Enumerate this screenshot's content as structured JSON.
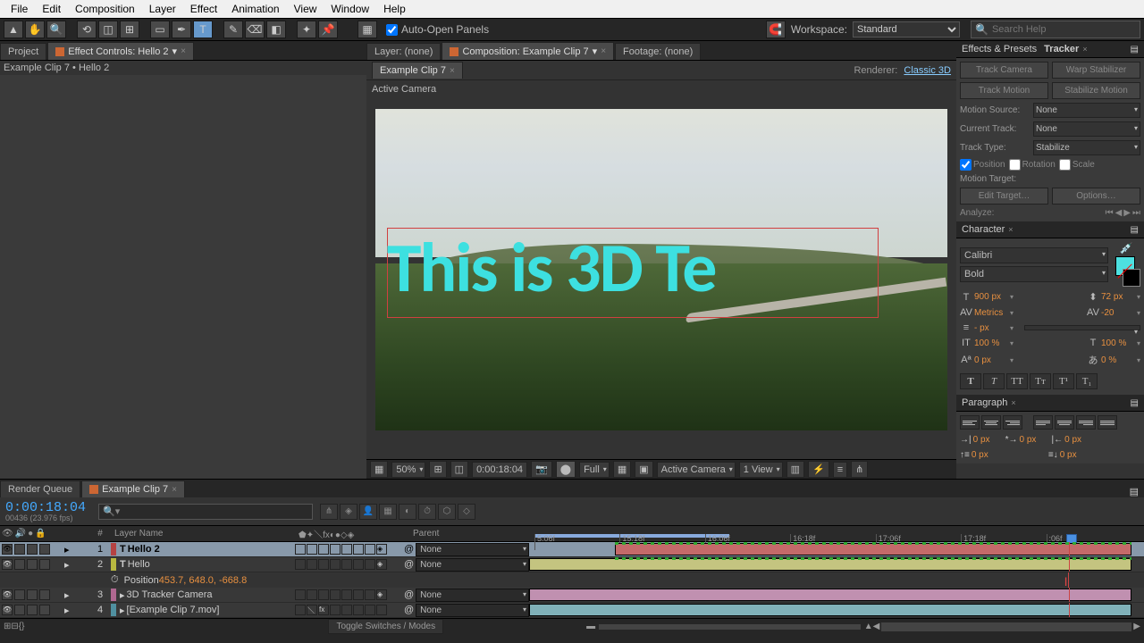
{
  "menubar": [
    "File",
    "Edit",
    "Composition",
    "Layer",
    "Effect",
    "Animation",
    "View",
    "Window",
    "Help"
  ],
  "toolbar": {
    "auto_open": "Auto-Open Panels",
    "workspace_label": "Workspace:",
    "workspace_value": "Standard",
    "search_placeholder": "Search Help"
  },
  "left": {
    "project_tab": "Project",
    "effect_tab": "Effect Controls: Hello 2",
    "subtext": "Example Clip 7 • Hello 2"
  },
  "center": {
    "layer_tab": "Layer: (none)",
    "comp_tab": "Composition: Example Clip 7",
    "footage_tab": "Footage: (none)",
    "tab2": "Example Clip 7",
    "renderer_label": "Renderer:",
    "renderer_value": "Classic 3D",
    "active_camera": "Active Camera",
    "text3d": "This is 3D Te",
    "footer": {
      "zoom": "50%",
      "time": "0:00:18:04",
      "quality": "Full",
      "camera": "Active Camera",
      "view": "1 View"
    }
  },
  "right": {
    "effects_presets": "Effects & Presets",
    "tracker": {
      "title": "Tracker",
      "track_camera": "Track Camera",
      "warp_stabilizer": "Warp Stabilizer",
      "track_motion": "Track Motion",
      "stabilize_motion": "Stabilize Motion",
      "motion_source": "Motion Source:",
      "motion_source_val": "None",
      "current_track": "Current Track:",
      "current_track_val": "None",
      "track_type": "Track Type:",
      "track_type_val": "Stabilize",
      "position": "Position",
      "rotation": "Rotation",
      "scale": "Scale",
      "motion_target": "Motion Target:",
      "edit_target": "Edit Target…",
      "options": "Options…",
      "analyze": "Analyze:"
    },
    "character": {
      "title": "Character",
      "font": "Calibri",
      "style": "Bold",
      "size": "900 px",
      "leading": "72 px",
      "kerning": "Metrics",
      "tracking": "-20",
      "stroke": "- px",
      "vscale": "100 %",
      "hscale": "100 %",
      "baseline": "0 px",
      "tsume": "0 %",
      "fill_color": "#4de0e0"
    },
    "paragraph": {
      "title": "Paragraph",
      "indent_left": "0 px",
      "indent_first": "0 px",
      "indent_right": "0 px",
      "space_before": "0 px",
      "space_after": "0 px"
    }
  },
  "timeline": {
    "render_queue": "Render Queue",
    "comp_tab": "Example Clip 7",
    "timecode": "0:00:18:04",
    "timecode_sub": "00436 (23.976 fps)",
    "col_layer_name": "Layer Name",
    "col_parent": "Parent",
    "ruler": [
      "5:06f",
      "15:18f",
      "16:06f",
      "16:18f",
      "17:06f",
      "17:18f",
      ":06f"
    ],
    "layers": [
      {
        "num": "1",
        "name": "Hello 2",
        "type": "T",
        "color": "#b54242",
        "parent": "None",
        "bar_color": "#c46a6a",
        "selected": true
      },
      {
        "num": "2",
        "name": "Hello",
        "type": "T",
        "color": "#b8b840",
        "parent": "None",
        "bar_color": "#c4c480",
        "selected": false
      },
      {
        "num": "3",
        "name": "3D Tracker Camera",
        "type": "",
        "color": "#b06890",
        "parent": "None",
        "bar_color": "#c090b0",
        "selected": false
      },
      {
        "num": "4",
        "name": "[Example Clip 7.mov]",
        "type": "",
        "color": "#5090a0",
        "parent": "None",
        "bar_color": "#80b0b8",
        "selected": false
      }
    ],
    "position_label": "Position",
    "position_value": "453.7, 648.0, -668.8",
    "toggle_switches": "Toggle Switches / Modes"
  }
}
